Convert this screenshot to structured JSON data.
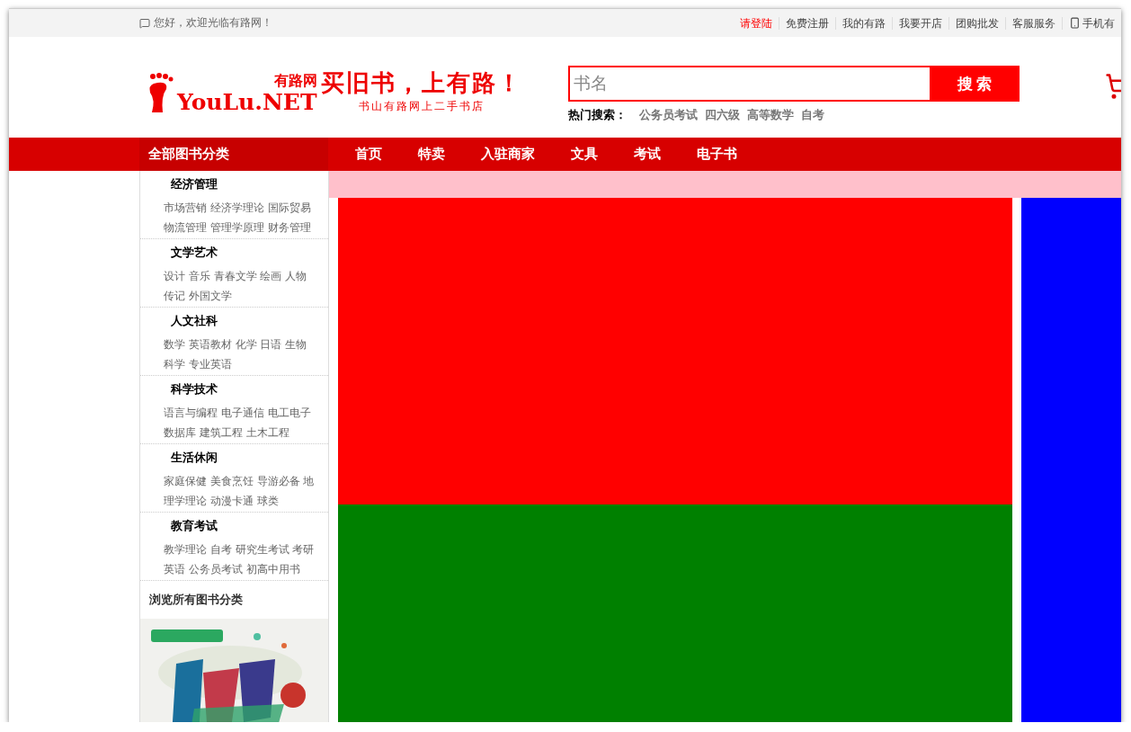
{
  "top_bar": {
    "greeting": "您好，欢迎光临有路网！",
    "links": [
      {
        "label": "请登陆",
        "highlighted": true
      },
      {
        "label": "免费注册",
        "highlighted": false
      },
      {
        "label": "我的有路",
        "highlighted": false
      },
      {
        "label": "我要开店",
        "highlighted": false
      },
      {
        "label": "团购批发",
        "highlighted": false
      },
      {
        "label": "客服服务",
        "highlighted": false
      },
      {
        "label": "手机有",
        "highlighted": false
      }
    ]
  },
  "logo": {
    "brand": "YouLu.NET",
    "site_name": "有路网",
    "slogan": "买旧书，上有路！",
    "subtitle": "书山有路网上二手书店"
  },
  "search": {
    "placeholder": "书名",
    "button": "搜 索",
    "hot_label": "热门搜索：",
    "hot_terms": [
      "公务员考试",
      "四六级",
      "高等数学",
      "自考"
    ]
  },
  "nav": {
    "category_button": "全部图书分类",
    "items": [
      "首页",
      "特卖",
      "入驻商家",
      "文具",
      "考试",
      "电子书"
    ]
  },
  "sidebar": {
    "categories": [
      {
        "title": "经济管理",
        "links": [
          "市场营销",
          "经济学理论",
          "国际贸易",
          "物流管理",
          "管理学原理",
          "财务管理"
        ]
      },
      {
        "title": "文学艺术",
        "links": [
          "设计",
          "音乐",
          "青春文学",
          "绘画",
          "人物传记",
          "外国文学"
        ]
      },
      {
        "title": "人文社科",
        "links": [
          "数学",
          "英语教材",
          "化学",
          "日语",
          "生物科学",
          "专业英语"
        ]
      },
      {
        "title": "科学技术",
        "links": [
          "语言与编程",
          "电子通信",
          "电工电子",
          "数据库",
          "建筑工程",
          "土木工程"
        ]
      },
      {
        "title": "生活休闲",
        "links": [
          "家庭保健",
          "美食烹饪",
          "导游必备",
          "地理学理论",
          "动漫卡通",
          "球类"
        ]
      },
      {
        "title": "教育考试",
        "links": [
          "教学理论",
          "自考",
          "研究生考试",
          "考研英语",
          "公务员考试",
          "初高中用书"
        ]
      }
    ],
    "browse_all": "浏览所有图书分类"
  },
  "content": {
    "strip": {
      "color": "#ffc0cb"
    },
    "blocks": [
      {
        "color": "#ff0000"
      },
      {
        "color": "#008000"
      }
    ],
    "side_block": {
      "color": "#0000ff"
    }
  }
}
